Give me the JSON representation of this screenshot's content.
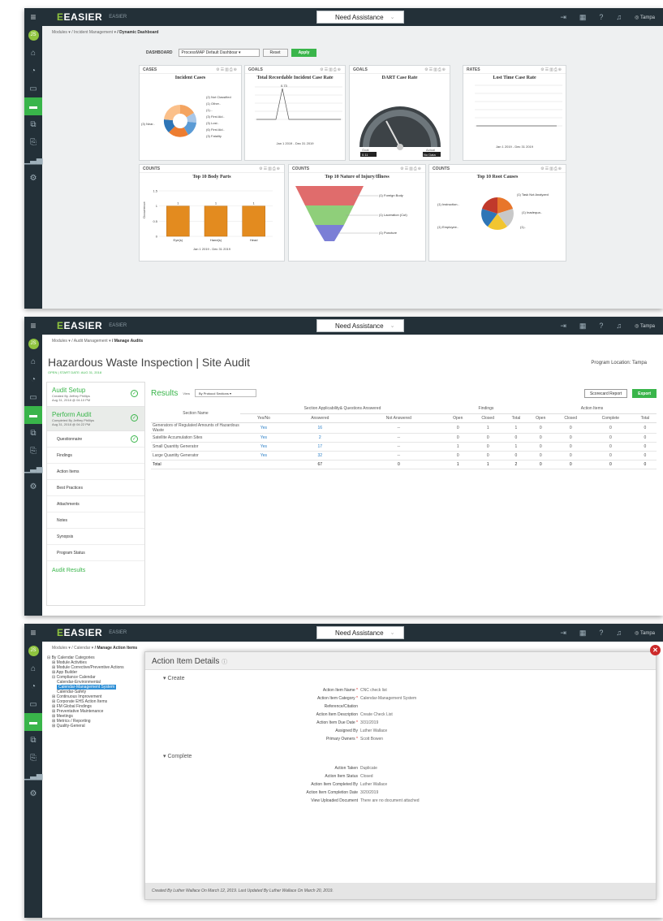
{
  "app": {
    "brand": "EASIER",
    "brand_sub": "EASIER",
    "assist": "Need Assistance",
    "user": "Tampa",
    "avatar": "JS"
  },
  "sidebar_icons": [
    "home-icon",
    "palette-icon",
    "monitor-icon",
    "active-module-icon",
    "tablet-icon",
    "export-icon",
    "chart-icon",
    "gear-icon"
  ],
  "panel1": {
    "crumbs": [
      "Modules ▾",
      "/ Incident Management ▾",
      "/ Dynamic Dashboard"
    ],
    "dashboard_label": "DASHBOARD",
    "dashboard_select": "ProcessMAP Default Dashboar",
    "reset": "Reset",
    "apply": "Apply",
    "widgets": [
      {
        "head": "CASES",
        "title": "Incident Cases",
        "footer": ""
      },
      {
        "head": "GOALS",
        "title": "Total Recordable Incident Case Rate",
        "footer": "Jan 1 2019 - Dec 31 2019"
      },
      {
        "head": "GOALS",
        "title": "DART Case Rate",
        "footer": ""
      },
      {
        "head": "RATES",
        "title": "Lost Time Case Rate",
        "footer": "Jan 1 2019 - Dec 31 2019"
      },
      {
        "head": "COUNTS",
        "title": "Top 10 Body Parts",
        "footer": "Jan 1 2019 - Dec 31 2019"
      },
      {
        "head": "COUNTS",
        "title": "Top 10 Nature of Injury/Illness",
        "footer": ""
      },
      {
        "head": "COUNTS",
        "title": "Top 10 Root Causes",
        "footer": ""
      }
    ],
    "pie_labels": [
      "(2) Not Classified",
      "(1) Other..",
      "(1)...",
      "(3) First Aid..",
      "(3) Lost..",
      "(6) First Aid..",
      "(3) Near..",
      "(3) Fatality"
    ],
    "bar_chart": {
      "categories": [
        "Eye(s)",
        "Hand(s)",
        "Head"
      ],
      "values": [
        1,
        1,
        1
      ],
      "ylabel": "Occurrence",
      "yticks": [
        "1.5",
        "1",
        "0.5",
        "0"
      ]
    },
    "funnel_labels": [
      "(1) Foreign Body",
      "(1) Laceration (Cut)",
      "(1) Puncture"
    ],
    "roots_labels": [
      "(1) Task Not Analyzed",
      "(1) Instruction..",
      "(1) Inadequa..",
      "(1) Employee..",
      "(1).."
    ],
    "trir_label": "0.73",
    "gauge": {
      "goal_label": "Goal",
      "goal": "0.11",
      "actual_label": "Actual",
      "actual": "No Data"
    }
  },
  "panel2": {
    "crumbs": [
      "Modules ▾",
      "/ Audit Management ▾",
      "/ Manage Audits"
    ],
    "title": "Hazardous Waste Inspection | Site Audit",
    "meta": "OPEN | START DATE: AUG 31, 2018",
    "program_location": "Program Location: Tampa",
    "nav_sections": [
      {
        "title": "Audit Setup",
        "sub1": "Created By Jeffrey Phillips",
        "sub2": "Aug 31, 2018 @ 04:10 PM"
      },
      {
        "title": "Perform Audit",
        "sub1": "Completed By Jeffrey Phillips",
        "sub2": "Aug 31, 2018 @ 04:22 PM"
      }
    ],
    "nav_items": [
      "Questionnaire",
      "Findings",
      "Action Items",
      "Best Practices",
      "Attachments",
      "Notes",
      "Synopsis",
      "Program Status"
    ],
    "nav_footer": "Audit Results",
    "results_title": "Results",
    "view_label": "View",
    "view_select": "By Protocol Sections",
    "scorecard": "Scorecard Report",
    "export": "Export",
    "group_headers": [
      "Section Applicability& Questions Answered",
      "Findings",
      "Action Items"
    ],
    "col_headers": [
      "Section Name",
      "Yes/No",
      "Answered",
      "Not Answered",
      "Open",
      "Closed",
      "Total",
      "Open",
      "Closed",
      "Complete",
      "Total"
    ],
    "rows": [
      [
        "Generators of Regulated Amounts of Hazardous Waste",
        "Yes",
        "16",
        "--",
        "0",
        "1",
        "1",
        "0",
        "0",
        "0",
        "0"
      ],
      [
        "Satellite Accumulation Sites",
        "Yes",
        "2",
        "--",
        "0",
        "0",
        "0",
        "0",
        "0",
        "0",
        "0"
      ],
      [
        "Small Quantity Generator",
        "Yes",
        "17",
        "--",
        "1",
        "0",
        "1",
        "0",
        "0",
        "0",
        "0"
      ],
      [
        "Large Quantity Generator",
        "Yes",
        "32",
        "--",
        "0",
        "0",
        "0",
        "0",
        "0",
        "0",
        "0"
      ],
      [
        "Total",
        "",
        "67",
        "0",
        "1",
        "1",
        "2",
        "0",
        "0",
        "0",
        "0"
      ]
    ]
  },
  "panel3": {
    "crumbs": [
      "Modules ▾",
      "/ Calendar ▾",
      "/ Manage Action Items"
    ],
    "tree": [
      {
        "t": "⊟ By Calendar Categories",
        "lvl": 0,
        "sel": false
      },
      {
        "t": "⊞ Module Activities",
        "lvl": 1,
        "sel": false
      },
      {
        "t": "⊞ Module Corrective/Preventive Actions",
        "lvl": 1,
        "sel": false
      },
      {
        "t": "⊞ App Builder",
        "lvl": 1,
        "sel": false
      },
      {
        "t": "⊟ Compliance Calendar",
        "lvl": 1,
        "sel": false
      },
      {
        "t": "Calendar-Environmental",
        "lvl": 2,
        "sel": false
      },
      {
        "t": "Calendar-Management System",
        "lvl": 2,
        "sel": true
      },
      {
        "t": "Calendar-Safety",
        "lvl": 2,
        "sel": false
      },
      {
        "t": "⊞ Continuous Improvement",
        "lvl": 1,
        "sel": false
      },
      {
        "t": "⊞ Corporate EHS Action Items",
        "lvl": 1,
        "sel": false
      },
      {
        "t": "⊞ FM Global Findings",
        "lvl": 1,
        "sel": false
      },
      {
        "t": "⊞ Preventative Maintenance",
        "lvl": 1,
        "sel": false
      },
      {
        "t": "⊞ Meetings",
        "lvl": 1,
        "sel": false
      },
      {
        "t": "⊞ Metrics / Reporting",
        "lvl": 1,
        "sel": false
      },
      {
        "t": "⊞ Quality-General",
        "lvl": 1,
        "sel": false
      }
    ],
    "modal_title": "Action Item Details",
    "create_label": "Create",
    "create_fields": [
      {
        "k": "Action Item Name",
        "req": true,
        "v": "CNC check list"
      },
      {
        "k": "Action Item Category",
        "req": true,
        "v": "Calendar-Management System"
      },
      {
        "k": "Reference/Citation",
        "req": false,
        "v": ""
      },
      {
        "k": "Action Item Description",
        "req": false,
        "v": "Create Check List"
      },
      {
        "k": "Action Item Due Date",
        "req": true,
        "v": "3/31/2019"
      },
      {
        "k": "Assigned By",
        "req": false,
        "v": "Luther Wallace"
      },
      {
        "k": "Primary Owners",
        "req": true,
        "v": "Scott Bowen"
      }
    ],
    "complete_label": "Complete",
    "complete_fields": [
      {
        "k": "Action Taken",
        "req": false,
        "v": "Duplicate"
      },
      {
        "k": "Action Item Status",
        "req": false,
        "v": "Closed"
      },
      {
        "k": "Action Item Completed By",
        "req": false,
        "v": "Luther Wallace"
      },
      {
        "k": "Action Item Completion Date",
        "req": false,
        "v": "3/20/2019"
      },
      {
        "k": "View Uploaded Document",
        "req": false,
        "v": "There are no document attached"
      }
    ],
    "footer": "Created By Luther Wallace On March 12, 2019. Last Updated By Luther Wallace On March 20, 2019."
  }
}
